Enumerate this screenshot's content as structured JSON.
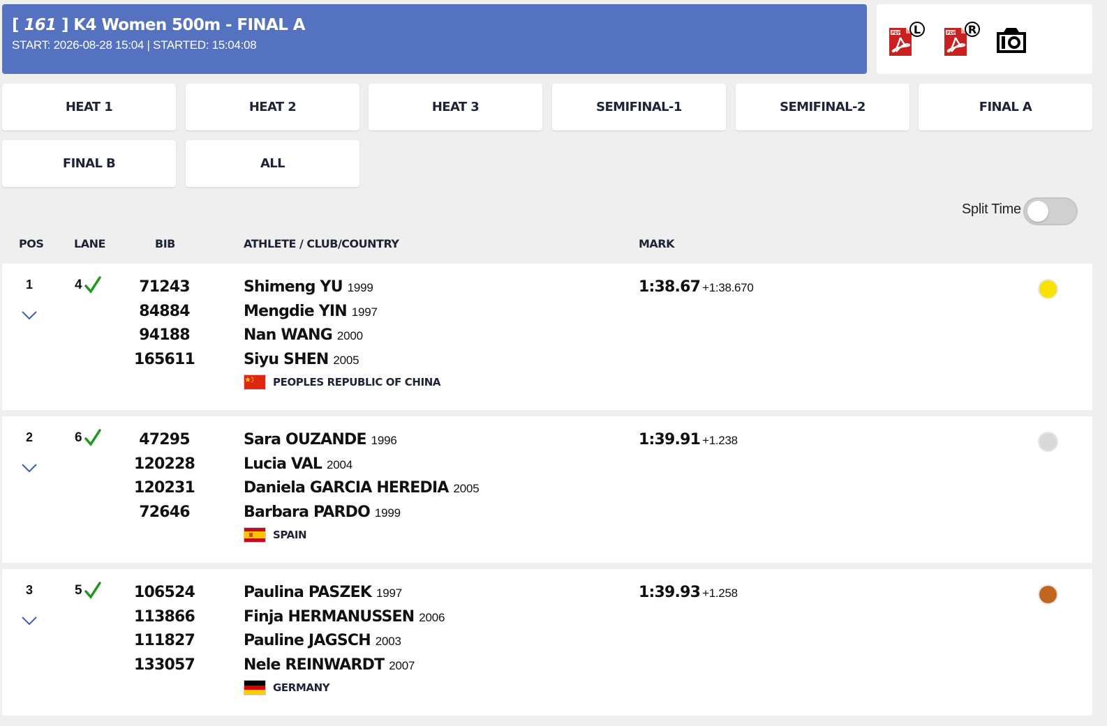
{
  "event": {
    "number": "161",
    "title": "K4 Women 500m - FINAL A",
    "start_label": "START:",
    "start": "2026-08-28 15:04",
    "started_label": "STARTED:",
    "started": "15:04:08"
  },
  "icons": {
    "pdf_left": "pdf-L-icon",
    "pdf_right": "pdf-R-icon",
    "camera": "camera-icon",
    "pdf_text": "PDF",
    "pdf_l_letter": "L",
    "pdf_r_letter": "R"
  },
  "tabs": [
    "HEAT 1",
    "HEAT 2",
    "HEAT 3",
    "SEMIFINAL-1",
    "SEMIFINAL-2",
    "FINAL A",
    "FINAL B",
    "ALL"
  ],
  "split_time": {
    "label": "Split Time",
    "on": false
  },
  "columns": {
    "pos": "POS",
    "lane": "LANE",
    "bib": "BIB",
    "athlete": "ATHLETE / CLUB/COUNTRY",
    "mark": "MARK"
  },
  "colors": {
    "header": "#5472bf",
    "check": "#1d9a1d",
    "gold": "#f7e200",
    "silver": "#d9d9d9",
    "bronze": "#c0661f"
  },
  "results": [
    {
      "pos": "1",
      "lane": "4",
      "bibs": [
        "71243",
        "84884",
        "94188",
        "165611"
      ],
      "athletes": [
        {
          "name": "Shimeng YU",
          "year": "1999"
        },
        {
          "name": "Mengdie YIN",
          "year": "1997"
        },
        {
          "name": "Nan WANG",
          "year": "2000"
        },
        {
          "name": "Siyu SHEN",
          "year": "2005"
        }
      ],
      "country": "PEOPLES REPUBLIC OF CHINA",
      "mark": "1:38.67",
      "diff": "+1:38.670",
      "medal": "gold"
    },
    {
      "pos": "2",
      "lane": "6",
      "bibs": [
        "47295",
        "120228",
        "120231",
        "72646"
      ],
      "athletes": [
        {
          "name": "Sara OUZANDE",
          "year": "1996"
        },
        {
          "name": "Lucia VAL",
          "year": "2004"
        },
        {
          "name": "Daniela GARCIA HEREDIA",
          "year": "2005"
        },
        {
          "name": "Barbara PARDO",
          "year": "1999"
        }
      ],
      "country": "SPAIN",
      "mark": "1:39.91",
      "diff": "+1.238",
      "medal": "silver"
    },
    {
      "pos": "3",
      "lane": "5",
      "bibs": [
        "106524",
        "113866",
        "111827",
        "133057"
      ],
      "athletes": [
        {
          "name": "Paulina PASZEK",
          "year": "1997"
        },
        {
          "name": "Finja HERMANUSSEN",
          "year": "2006"
        },
        {
          "name": "Pauline JAGSCH",
          "year": "2003"
        },
        {
          "name": "Nele REINWARDT",
          "year": "2007"
        }
      ],
      "country": "GERMANY",
      "mark": "1:39.93",
      "diff": "+1.258",
      "medal": "bronze"
    }
  ]
}
